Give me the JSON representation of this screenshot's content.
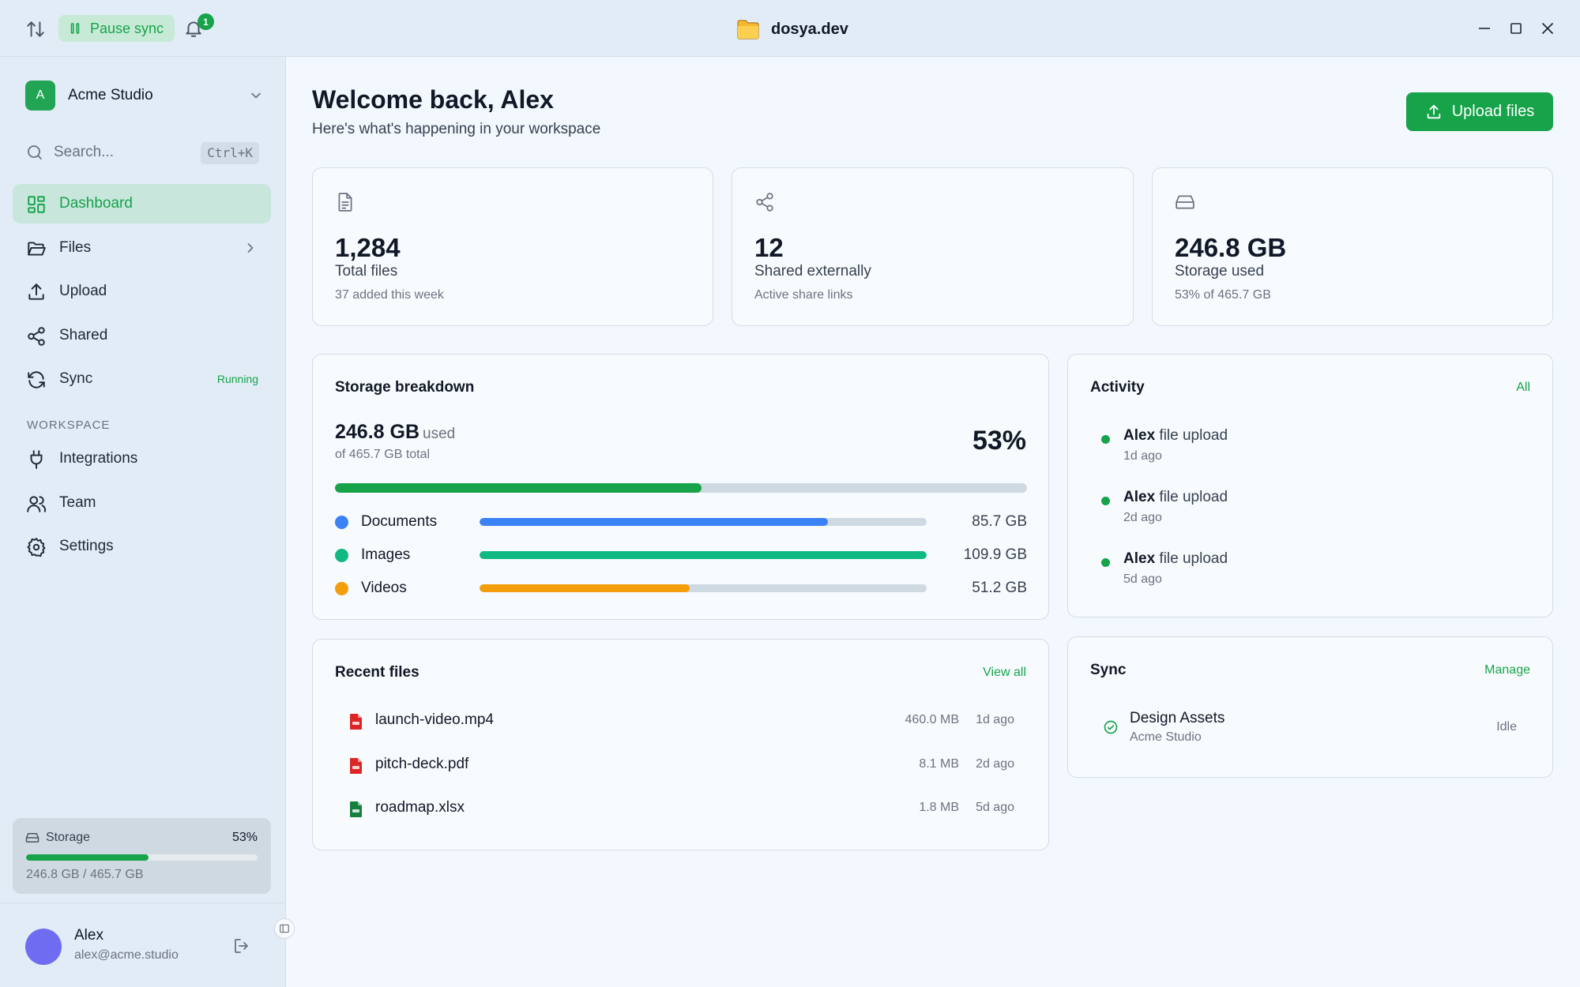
{
  "titlebar": {
    "pause_label": "Pause sync",
    "notifications_count": "1",
    "app_title": "dosya.dev"
  },
  "sidebar": {
    "workspace": {
      "avatar_letter": "A",
      "name": "Acme Studio"
    },
    "search": {
      "placeholder": "Search...",
      "shortcut": "Ctrl+K"
    },
    "nav": [
      {
        "label": "Dashboard",
        "icon": "grid-icon",
        "active": true
      },
      {
        "label": "Files",
        "icon": "folder-icon"
      },
      {
        "label": "Upload",
        "icon": "upload-icon"
      },
      {
        "label": "Shared",
        "icon": "share-icon"
      },
      {
        "label": "Sync",
        "icon": "refresh-icon",
        "badge": "Running"
      }
    ],
    "section_label": "WORKSPACE",
    "workspace_nav": [
      {
        "label": "Integrations",
        "icon": "plug-icon"
      },
      {
        "label": "Team",
        "icon": "users-icon"
      },
      {
        "label": "Settings",
        "icon": "gear-icon"
      }
    ],
    "storage": {
      "label": "Storage",
      "percent": "53%",
      "fraction": 0.53,
      "detail": "246.8 GB / 465.7 GB"
    },
    "user": {
      "name": "Alex",
      "email": "alex@acme.studio"
    }
  },
  "header": {
    "title": "Welcome back, Alex",
    "subtitle": "Here's what's happening in your workspace",
    "upload_label": "Upload files"
  },
  "stats": [
    {
      "value": "1,284",
      "label": "Total files",
      "sub": "37 added this week",
      "icon": "file-icon"
    },
    {
      "value": "12",
      "label": "Shared externally",
      "sub": "Active share links",
      "icon": "share-icon"
    },
    {
      "value": "246.8 GB",
      "label": "Storage used",
      "sub": "53% of 465.7 GB",
      "icon": "hard-drive-icon"
    }
  ],
  "storage_breakdown": {
    "title": "Storage breakdown",
    "used": "246.8 GB",
    "used_word": "used",
    "total": "of 465.7 GB total",
    "percent": "53%",
    "fraction": 0.53,
    "categories": [
      {
        "name": "Documents",
        "size": "85.7 GB",
        "fraction": 0.78,
        "color": "#3b82f6"
      },
      {
        "name": "Images",
        "size": "109.9 GB",
        "fraction": 1.0,
        "color": "#10b981"
      },
      {
        "name": "Videos",
        "size": "51.2 GB",
        "fraction": 0.47,
        "color": "#f59e0b"
      }
    ]
  },
  "activity": {
    "title": "Activity",
    "link": "All",
    "items": [
      {
        "user": "Alex",
        "action": "file upload",
        "time": "1d ago"
      },
      {
        "user": "Alex",
        "action": "file upload",
        "time": "2d ago"
      },
      {
        "user": "Alex",
        "action": "file upload",
        "time": "5d ago"
      }
    ]
  },
  "recent_files": {
    "title": "Recent files",
    "link": "View all",
    "items": [
      {
        "name": "launch-video.mp4",
        "size": "460.0 MB",
        "time": "1d ago",
        "color": "#dc2626"
      },
      {
        "name": "pitch-deck.pdf",
        "size": "8.1 MB",
        "time": "2d ago",
        "color": "#dc2626"
      },
      {
        "name": "roadmap.xlsx",
        "size": "1.8 MB",
        "time": "5d ago",
        "color": "#15803d"
      }
    ]
  },
  "sync": {
    "title": "Sync",
    "link": "Manage",
    "items": [
      {
        "name": "Design Assets",
        "workspace": "Acme Studio",
        "status": "Idle"
      }
    ]
  },
  "colors": {
    "accent": "#16a34a",
    "bg": "#f2f8fd",
    "sidebar": "#e1ecf6"
  }
}
